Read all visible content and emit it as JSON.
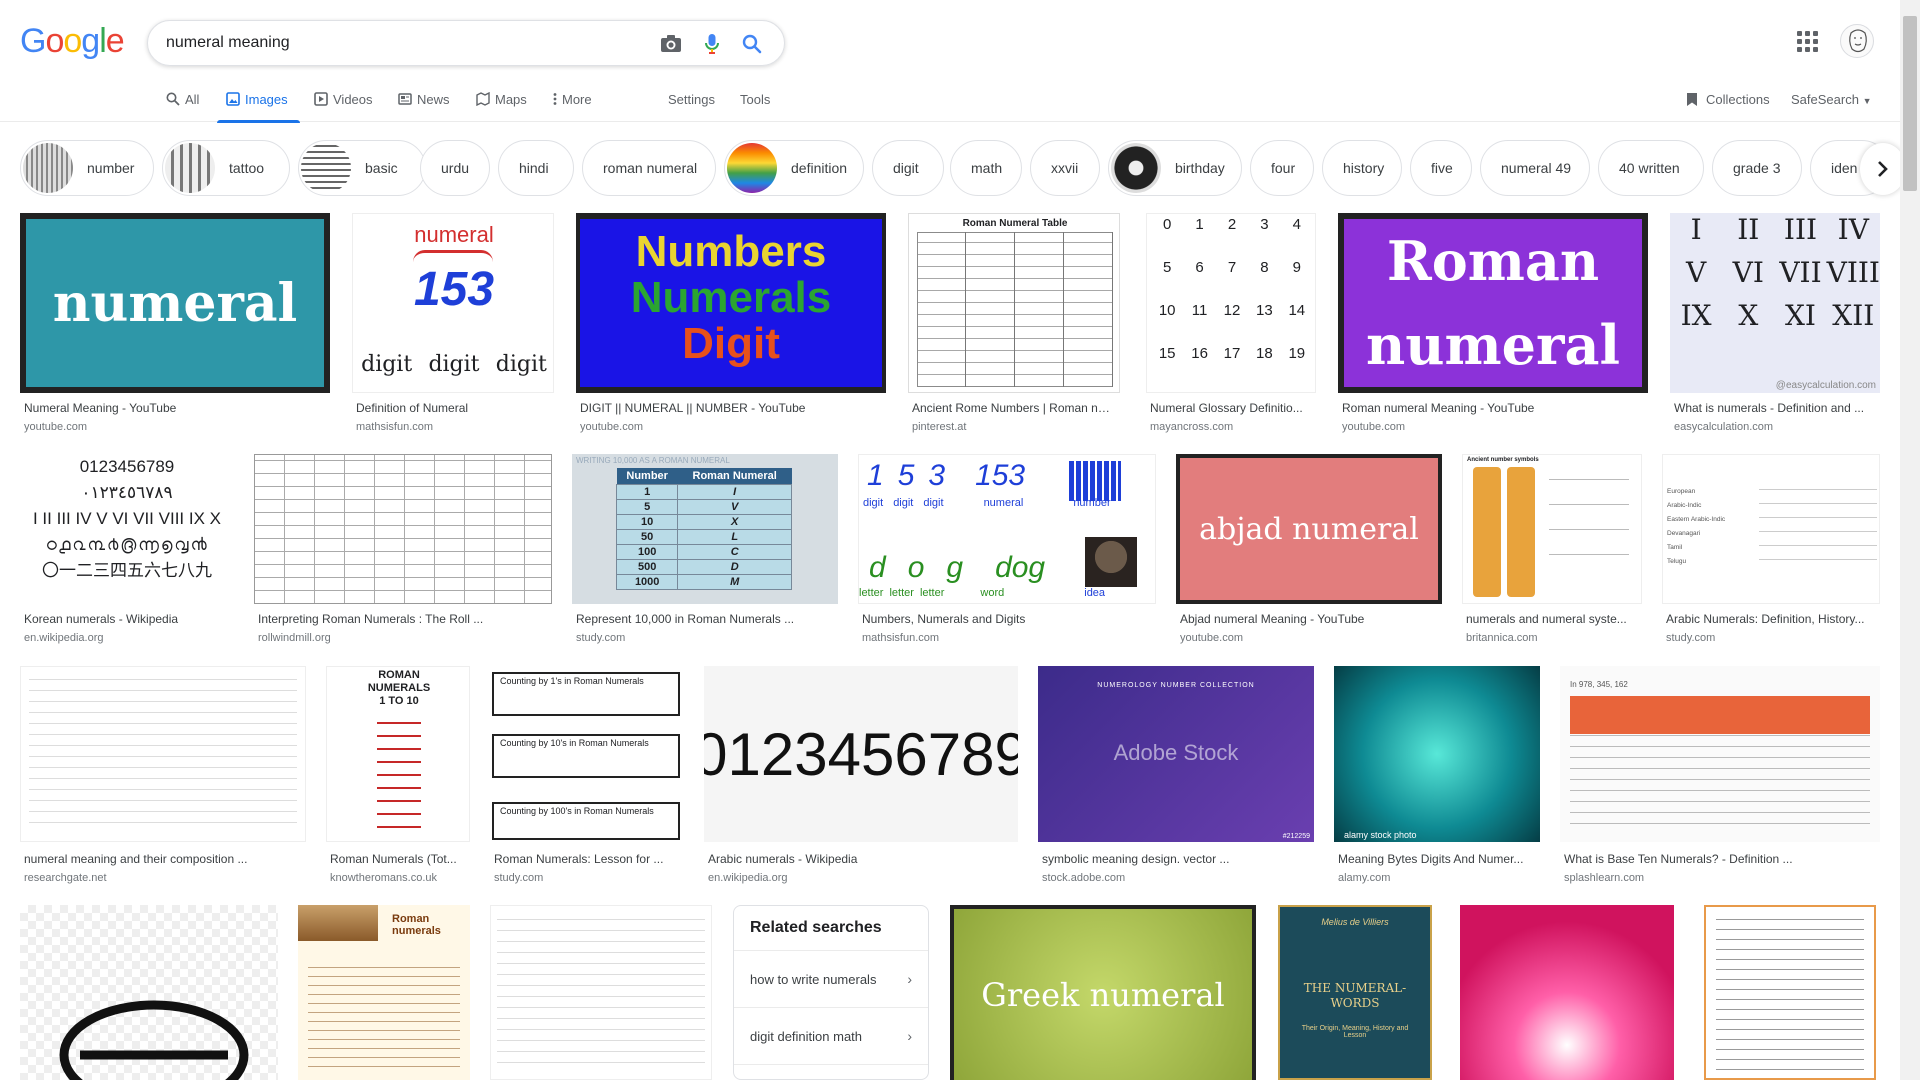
{
  "search": {
    "query": "numeral meaning"
  },
  "logo": "Google",
  "tabs": [
    {
      "label": "All",
      "icon": "search-icon"
    },
    {
      "label": "Images",
      "icon": "image-icon",
      "active": true
    },
    {
      "label": "Videos",
      "icon": "video-icon"
    },
    {
      "label": "News",
      "icon": "news-icon"
    },
    {
      "label": "Maps",
      "icon": "map-icon"
    },
    {
      "label": "More",
      "icon": "more-vert-icon"
    }
  ],
  "tools": {
    "settings": "Settings",
    "tools": "Tools",
    "collections": "Collections",
    "safesearch": "SafeSearch"
  },
  "chips": [
    "number",
    "tattoo",
    "basic",
    "urdu",
    "hindi",
    "roman numeral",
    "definition",
    "digit",
    "math",
    "xxvii",
    "birthday",
    "four",
    "history",
    "five",
    "numeral 49",
    "40 written",
    "grade 3",
    "iden"
  ],
  "results": [
    {
      "title": "Numeral Meaning - YouTube",
      "source": "youtube.com",
      "caption": "numeral"
    },
    {
      "title": "Definition of Numeral",
      "source": "mathsisfun.com",
      "caption": "numeral",
      "num": "153",
      "words": [
        "digit",
        "digit",
        "digit"
      ]
    },
    {
      "title": "DIGIT || NUMERAL || NUMBER - YouTube",
      "source": "youtube.com",
      "lines": [
        "Numbers",
        "Numerals",
        "Digit"
      ]
    },
    {
      "title": "Ancient Rome Numbers | Roman nu...",
      "source": "pinterest.at",
      "caption": "Roman Numeral Table"
    },
    {
      "title": "Numeral Glossary Definitio...",
      "source": "mayancross.com",
      "digits": [
        "0",
        "1",
        "2",
        "3",
        "4",
        "5",
        "6",
        "7",
        "8",
        "9",
        "10",
        "11",
        "12",
        "13",
        "14",
        "15",
        "16",
        "17",
        "18",
        "19"
      ]
    },
    {
      "title": "Roman numeral Meaning - YouTube",
      "source": "youtube.com",
      "lines": [
        "Roman",
        "numeral"
      ]
    },
    {
      "title": "What is numerals - Definition and ...",
      "source": "easycalculation.com",
      "romans": [
        "I",
        "II",
        "III",
        "IV",
        "V",
        "VI",
        "VII",
        "VIII",
        "IX",
        "X",
        "XI",
        "XII"
      ],
      "watermark": "@easycalculation.com"
    },
    {
      "title": "Korean numerals - Wikipedia",
      "source": "en.wikipedia.org",
      "lines": [
        "0123456789",
        "٠١٢٣٤٥٦٧٨٩",
        "I II III IV V VI VII VIII IX X",
        "〇一二三四五六七八九"
      ]
    },
    {
      "title": "Interpreting Roman Numerals : The Roll ...",
      "source": "rollwindmill.org"
    },
    {
      "title": "Represent 10,000 in Roman Numerals ...",
      "source": "study.com",
      "table_head": [
        "Number",
        "Roman Numeral"
      ],
      "table": [
        [
          "1",
          "I"
        ],
        [
          "5",
          "V"
        ],
        [
          "10",
          "X"
        ],
        [
          "50",
          "L"
        ],
        [
          "100",
          "C"
        ],
        [
          "500",
          "D"
        ],
        [
          "1000",
          "M"
        ]
      ],
      "banner": "WRITING 10,000 AS A ROMAN NUMERAL"
    },
    {
      "title": "Numbers, Numerals and Digits",
      "source": "mathsisfun.com",
      "top": [
        "1",
        "5",
        "3",
        "153"
      ],
      "toplabels": [
        "digit",
        "digit",
        "digit",
        "numeral",
        "number"
      ],
      "bottom": [
        "d",
        "o",
        "g",
        "dog"
      ],
      "bottomlabels": [
        "letter",
        "letter",
        "letter",
        "word",
        "idea"
      ]
    },
    {
      "title": "Abjad numeral Meaning - YouTube",
      "source": "youtube.com",
      "caption": "abjad numeral"
    },
    {
      "title": "numerals and numeral syste...",
      "source": "britannica.com",
      "caption": "Ancient number symbols"
    },
    {
      "title": "Arabic Numerals: Definition, History...",
      "source": "study.com",
      "rows": [
        "European",
        "Arabic-Indic",
        "Eastern Arabic-Indic",
        "Devanagari",
        "Tamil",
        "Telugu"
      ]
    },
    {
      "title": "numeral meaning and their composition ...",
      "source": "researchgate.net"
    },
    {
      "title": "Roman Numerals (Tot...",
      "source": "knowtheromans.co.uk",
      "caption": "ROMAN NUMERALS 1 TO 10"
    },
    {
      "title": "Roman Numerals: Lesson for ...",
      "source": "study.com",
      "boxes": [
        "Counting by 1's in Roman Numerals",
        "Counting by 10's in Roman Numerals",
        "Counting by 100's in Roman Numerals"
      ]
    },
    {
      "title": "Arabic numerals - Wikipedia",
      "source": "en.wikipedia.org",
      "caption": "0123456789"
    },
    {
      "title": "symbolic meaning design. vector ...",
      "source": "stock.adobe.com",
      "caption": "NUMEROLOGY NUMBER COLLECTION",
      "watermark": "Adobe Stock",
      "id": "#212259"
    },
    {
      "title": "Meaning Bytes Digits And Numer...",
      "source": "alamy.com",
      "watermark": "alamy stock photo"
    },
    {
      "title": "What is Base Ten Numerals? - Definition ...",
      "source": "splashlearn.com",
      "header": "In 978, 345, 162"
    },
    {
      "title": "",
      "source": ""
    },
    {
      "title": "",
      "source": "",
      "caption": "Roman numerals"
    },
    {
      "title": "",
      "source": ""
    },
    {
      "title": "",
      "source": "",
      "caption": "Greek numeral"
    },
    {
      "title": "",
      "source": "",
      "author": "Melius de Villiers",
      "caption": "THE NUMERAL-WORDS",
      "sub": "Their Origin, Meaning, History and Lesson"
    },
    {
      "title": "",
      "source": ""
    },
    {
      "title": "",
      "source": ""
    }
  ],
  "related": {
    "heading": "Related searches",
    "items": [
      "how to write numerals",
      "digit definition math"
    ]
  },
  "colors": {
    "accent": "#1a73e8",
    "blue": "#4285f4",
    "red": "#ea4335",
    "yellow": "#fbbc05",
    "green": "#34a853"
  }
}
